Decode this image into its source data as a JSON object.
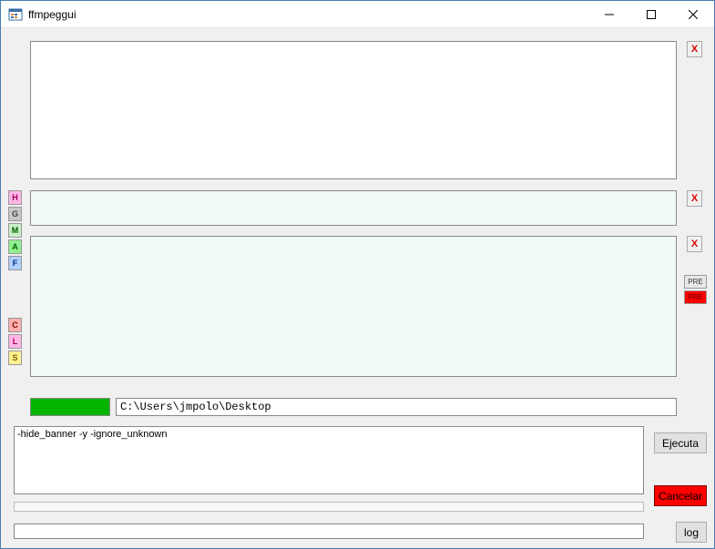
{
  "title": "ffmpeggui",
  "window": {
    "minimize": "—",
    "maximize": "☐",
    "close": "✕"
  },
  "sideTop": {
    "H": "H",
    "G": "G",
    "M": "M",
    "A": "A",
    "F": "F"
  },
  "sideBot": {
    "C": "C",
    "L": "L",
    "S": "S"
  },
  "xlabel": "X",
  "pre": {
    "p1": "PRE",
    "p2": "PRE"
  },
  "path": "C:\\Users\\jmpolo\\Desktop",
  "args": "-hide_banner -y -ignore_unknown",
  "buttons": {
    "ejecuta": "Ejecuta",
    "cancelar": "Cancelar",
    "log": "log"
  }
}
